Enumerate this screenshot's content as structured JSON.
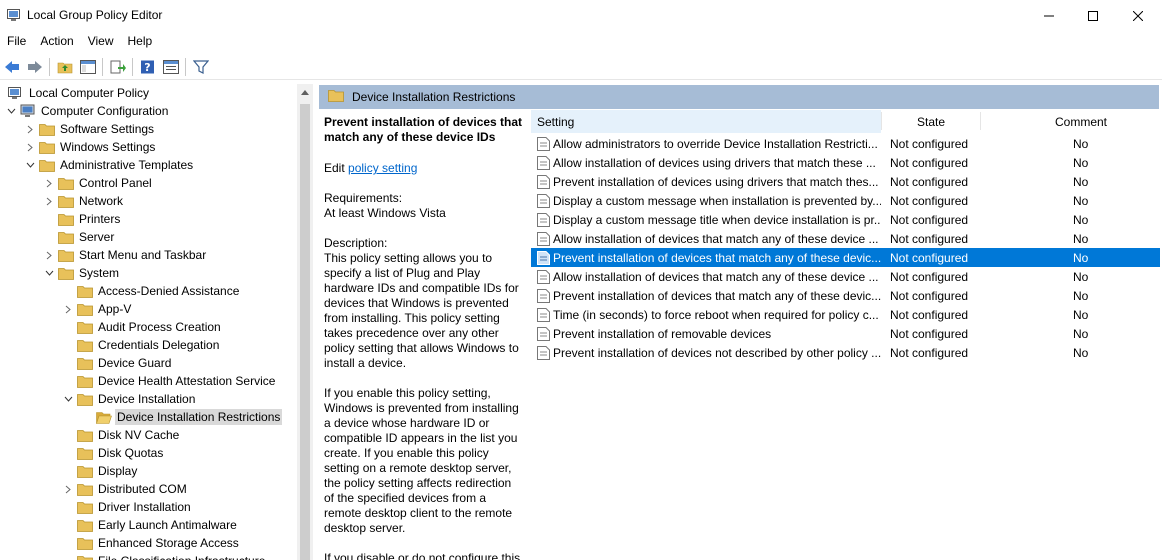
{
  "window": {
    "title": "Local Group Policy Editor"
  },
  "menu": [
    "File",
    "Action",
    "View",
    "Help"
  ],
  "tree": {
    "items": [
      {
        "label": "Local Computer Policy",
        "level": 0,
        "expander": "",
        "icon": "computer-policy-icon"
      },
      {
        "label": "Computer Configuration",
        "level": 1,
        "expander": "expanded",
        "icon": "computer-icon"
      },
      {
        "label": "Software Settings",
        "level": 2,
        "expander": "collapsed",
        "icon": "folder-icon"
      },
      {
        "label": "Windows Settings",
        "level": 2,
        "expander": "collapsed",
        "icon": "folder-icon"
      },
      {
        "label": "Administrative Templates",
        "level": 2,
        "expander": "expanded",
        "icon": "folder-icon"
      },
      {
        "label": "Control Panel",
        "level": 3,
        "expander": "collapsed",
        "icon": "folder-icon"
      },
      {
        "label": "Network",
        "level": 3,
        "expander": "collapsed",
        "icon": "folder-icon"
      },
      {
        "label": "Printers",
        "level": 3,
        "expander": "",
        "icon": "folder-icon"
      },
      {
        "label": "Server",
        "level": 3,
        "expander": "",
        "icon": "folder-icon"
      },
      {
        "label": "Start Menu and Taskbar",
        "level": 3,
        "expander": "collapsed",
        "icon": "folder-icon"
      },
      {
        "label": "System",
        "level": 3,
        "expander": "expanded",
        "icon": "folder-icon"
      },
      {
        "label": "Access-Denied Assistance",
        "level": 4,
        "expander": "",
        "icon": "folder-icon"
      },
      {
        "label": "App-V",
        "level": 4,
        "expander": "collapsed",
        "icon": "folder-icon"
      },
      {
        "label": "Audit Process Creation",
        "level": 4,
        "expander": "",
        "icon": "folder-icon"
      },
      {
        "label": "Credentials Delegation",
        "level": 4,
        "expander": "",
        "icon": "folder-icon"
      },
      {
        "label": "Device Guard",
        "level": 4,
        "expander": "",
        "icon": "folder-icon"
      },
      {
        "label": "Device Health Attestation Service",
        "level": 4,
        "expander": "",
        "icon": "folder-icon"
      },
      {
        "label": "Device Installation",
        "level": 4,
        "expander": "expanded",
        "icon": "folder-icon"
      },
      {
        "label": "Device Installation Restrictions",
        "level": 5,
        "expander": "",
        "icon": "folder-open-icon",
        "selected": true
      },
      {
        "label": "Disk NV Cache",
        "level": 4,
        "expander": "",
        "icon": "folder-icon"
      },
      {
        "label": "Disk Quotas",
        "level": 4,
        "expander": "",
        "icon": "folder-icon"
      },
      {
        "label": "Display",
        "level": 4,
        "expander": "",
        "icon": "folder-icon"
      },
      {
        "label": "Distributed COM",
        "level": 4,
        "expander": "collapsed",
        "icon": "folder-icon"
      },
      {
        "label": "Driver Installation",
        "level": 4,
        "expander": "",
        "icon": "folder-icon"
      },
      {
        "label": "Early Launch Antimalware",
        "level": 4,
        "expander": "",
        "icon": "folder-icon"
      },
      {
        "label": "Enhanced Storage Access",
        "level": 4,
        "expander": "",
        "icon": "folder-icon"
      },
      {
        "label": "File Classification Infrastructure",
        "level": 4,
        "expander": "",
        "icon": "folder-icon"
      }
    ]
  },
  "right": {
    "header_title": "Device Installation Restrictions",
    "description": {
      "title": "Prevent installation of devices that match any of these device IDs",
      "edit_prefix": "Edit",
      "edit_link": "policy setting",
      "requirements_label": "Requirements:",
      "requirements_value": "At least Windows Vista",
      "description_label": "Description:",
      "p1": "This policy setting allows you to specify a list of Plug and Play hardware IDs and compatible IDs for devices that Windows is prevented from installing. This policy setting takes precedence over any other policy setting that allows Windows to install a device.",
      "p2": "If you enable this policy setting, Windows is prevented from installing a device whose hardware ID or compatible ID appears in the list you create. If you enable this policy setting on a remote desktop server, the policy setting affects redirection of the specified devices from a remote desktop client to the remote desktop server.",
      "p3": "If you disable or do not configure this"
    },
    "columns": {
      "setting": "Setting",
      "state": "State",
      "comment": "Comment"
    },
    "rows": [
      {
        "setting": "Allow administrators to override Device Installation Restricti...",
        "state": "Not configured",
        "comment": "No"
      },
      {
        "setting": "Allow installation of devices using drivers that match these ...",
        "state": "Not configured",
        "comment": "No"
      },
      {
        "setting": "Prevent installation of devices using drivers that match thes...",
        "state": "Not configured",
        "comment": "No"
      },
      {
        "setting": "Display a custom message when installation is prevented by...",
        "state": "Not configured",
        "comment": "No"
      },
      {
        "setting": "Display a custom message title when device installation is pr...",
        "state": "Not configured",
        "comment": "No"
      },
      {
        "setting": "Allow installation of devices that match any of these device ...",
        "state": "Not configured",
        "comment": "No"
      },
      {
        "setting": "Prevent installation of devices that match any of these devic...",
        "state": "Not configured",
        "comment": "No",
        "selected": true
      },
      {
        "setting": "Allow installation of devices that match any of these device ...",
        "state": "Not configured",
        "comment": "No"
      },
      {
        "setting": "Prevent installation of devices that match any of these devic...",
        "state": "Not configured",
        "comment": "No"
      },
      {
        "setting": "Time (in seconds) to force reboot when required for policy c...",
        "state": "Not configured",
        "comment": "No"
      },
      {
        "setting": "Prevent installation of removable devices",
        "state": "Not configured",
        "comment": "No"
      },
      {
        "setting": "Prevent installation of devices not described by other policy ...",
        "state": "Not configured",
        "comment": "No"
      }
    ]
  },
  "colors": {
    "selection": "#0078d7",
    "header_band": "#a6bcd6",
    "folder": "#e8c15a",
    "link": "#0066cc"
  }
}
